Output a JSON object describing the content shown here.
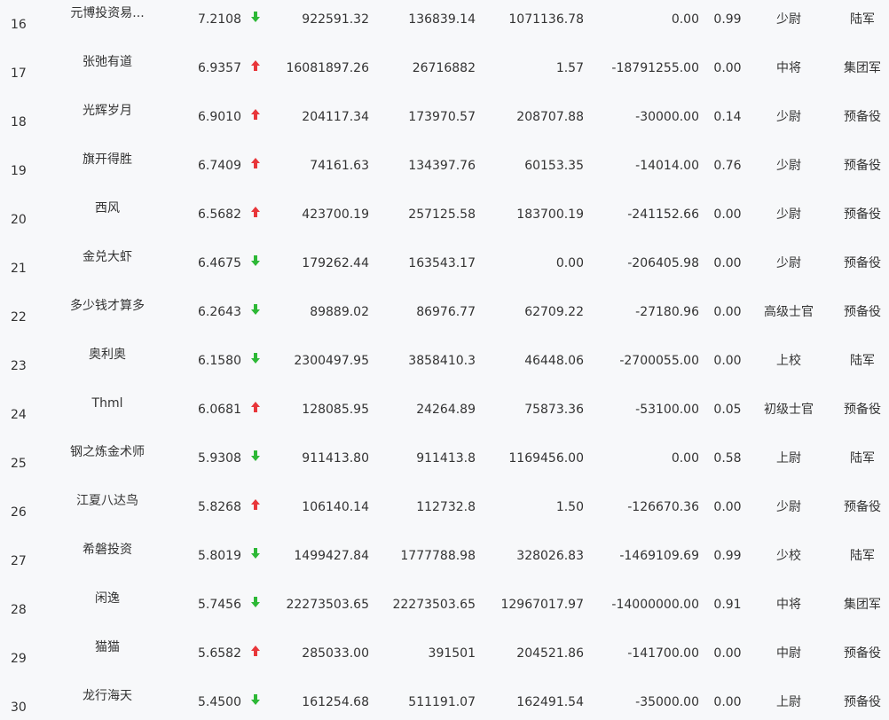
{
  "colors": {
    "up": "#e8363a",
    "down": "#2db836",
    "text": "#333333",
    "background": "#f7f8fa"
  },
  "rows": [
    {
      "rank": "16",
      "name": "元博投资易...",
      "score": "7.2108",
      "trend": "down",
      "v1": "922591.32",
      "v2": "136839.14",
      "v3": "1071136.78",
      "v4": "0.00",
      "ratio": "0.99",
      "title": "少尉",
      "branch": "陆军"
    },
    {
      "rank": "17",
      "name": "张弛有道",
      "score": "6.9357",
      "trend": "up",
      "v1": "16081897.26",
      "v2": "26716882",
      "v3": "1.57",
      "v4": "-18791255.00",
      "ratio": "0.00",
      "title": "中将",
      "branch": "集团军"
    },
    {
      "rank": "18",
      "name": "光辉岁月",
      "score": "6.9010",
      "trend": "up",
      "v1": "204117.34",
      "v2": "173970.57",
      "v3": "208707.88",
      "v4": "-30000.00",
      "ratio": "0.14",
      "title": "少尉",
      "branch": "预备役"
    },
    {
      "rank": "19",
      "name": "旗开得胜",
      "score": "6.7409",
      "trend": "up",
      "v1": "74161.63",
      "v2": "134397.76",
      "v3": "60153.35",
      "v4": "-14014.00",
      "ratio": "0.76",
      "title": "少尉",
      "branch": "预备役"
    },
    {
      "rank": "20",
      "name": "西风",
      "score": "6.5682",
      "trend": "up",
      "v1": "423700.19",
      "v2": "257125.58",
      "v3": "183700.19",
      "v4": "-241152.66",
      "ratio": "0.00",
      "title": "少尉",
      "branch": "预备役"
    },
    {
      "rank": "21",
      "name": "金兑大虾",
      "score": "6.4675",
      "trend": "down",
      "v1": "179262.44",
      "v2": "163543.17",
      "v3": "0.00",
      "v4": "-206405.98",
      "ratio": "0.00",
      "title": "少尉",
      "branch": "预备役"
    },
    {
      "rank": "22",
      "name": "多少钱才算多",
      "score": "6.2643",
      "trend": "down",
      "v1": "89889.02",
      "v2": "86976.77",
      "v3": "62709.22",
      "v4": "-27180.96",
      "ratio": "0.00",
      "title": "高级士官",
      "branch": "预备役"
    },
    {
      "rank": "23",
      "name": "奥利奥",
      "score": "6.1580",
      "trend": "down",
      "v1": "2300497.95",
      "v2": "3858410.3",
      "v3": "46448.06",
      "v4": "-2700055.00",
      "ratio": "0.00",
      "title": "上校",
      "branch": "陆军"
    },
    {
      "rank": "24",
      "name": "Thml",
      "score": "6.0681",
      "trend": "up",
      "v1": "128085.95",
      "v2": "24264.89",
      "v3": "75873.36",
      "v4": "-53100.00",
      "ratio": "0.05",
      "title": "初级士官",
      "branch": "预备役"
    },
    {
      "rank": "25",
      "name": "钢之炼金术师",
      "score": "5.9308",
      "trend": "down",
      "v1": "911413.80",
      "v2": "911413.8",
      "v3": "1169456.00",
      "v4": "0.00",
      "ratio": "0.58",
      "title": "上尉",
      "branch": "陆军"
    },
    {
      "rank": "26",
      "name": "江夏八达鸟",
      "score": "5.8268",
      "trend": "up",
      "v1": "106140.14",
      "v2": "112732.8",
      "v3": "1.50",
      "v4": "-126670.36",
      "ratio": "0.00",
      "title": "少尉",
      "branch": "预备役"
    },
    {
      "rank": "27",
      "name": "希磐投资",
      "score": "5.8019",
      "trend": "down",
      "v1": "1499427.84",
      "v2": "1777788.98",
      "v3": "328026.83",
      "v4": "-1469109.69",
      "ratio": "0.99",
      "title": "少校",
      "branch": "陆军"
    },
    {
      "rank": "28",
      "name": "闲逸",
      "score": "5.7456",
      "trend": "down",
      "v1": "22273503.65",
      "v2": "22273503.65",
      "v3": "12967017.97",
      "v4": "-14000000.00",
      "ratio": "0.91",
      "title": "中将",
      "branch": "集团军"
    },
    {
      "rank": "29",
      "name": "猫猫",
      "score": "5.6582",
      "trend": "up",
      "v1": "285033.00",
      "v2": "391501",
      "v3": "204521.86",
      "v4": "-141700.00",
      "ratio": "0.00",
      "title": "中尉",
      "branch": "预备役"
    },
    {
      "rank": "30",
      "name": "龙行海天",
      "score": "5.4500",
      "trend": "down",
      "v1": "161254.68",
      "v2": "511191.07",
      "v3": "162491.54",
      "v4": "-35000.00",
      "ratio": "0.00",
      "title": "上尉",
      "branch": "预备役"
    }
  ]
}
